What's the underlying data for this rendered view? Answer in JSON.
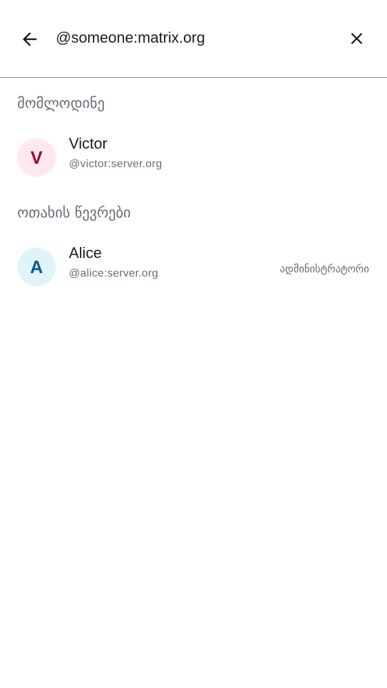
{
  "search": {
    "query": "@someone:matrix.org",
    "back_icon": "arrow-left-icon",
    "clear_icon": "close-icon"
  },
  "sections": [
    {
      "title": "მომლოდინე",
      "members": [
        {
          "initial": "V",
          "name": "Victor",
          "id": "@victor:server.org",
          "avatar_bg": "#ffe9ef",
          "avatar_fg": "#9b0046"
        }
      ]
    },
    {
      "title": "ოთახის წევრები",
      "members": [
        {
          "initial": "A",
          "name": "Alice",
          "id": "@alice:server.org",
          "role": "ადმინისტრატორი",
          "avatar_bg": "#e0f3f8",
          "avatar_fg": "#005c8e"
        }
      ]
    }
  ]
}
